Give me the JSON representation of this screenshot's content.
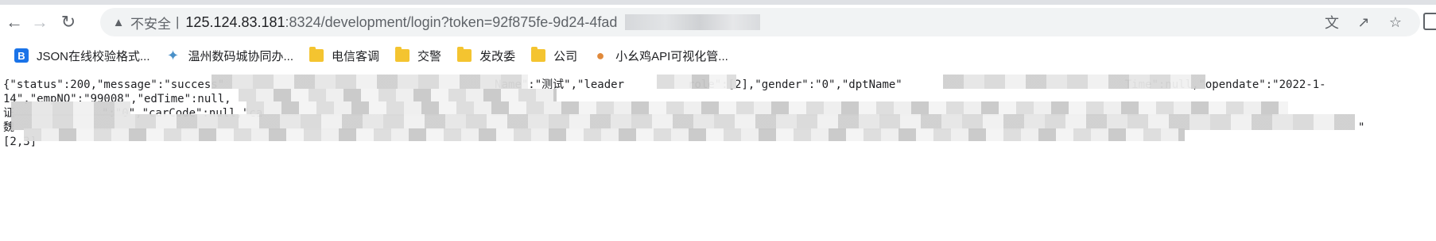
{
  "browser": {
    "nav": {
      "back_icon": "arrow-back-icon",
      "forward_icon": "arrow-forward-icon",
      "reload_icon": "reload-icon"
    },
    "omnibox": {
      "security_icon": "warning-triangle-icon",
      "security_label": "不安全",
      "separator": "|",
      "url_host": "125.124.83.181",
      "url_rest": ":8324/development/login?token=92f875fe-9d24-4fad",
      "actions": [
        "translate-icon",
        "share-icon",
        "bookmark-star-icon"
      ]
    }
  },
  "bookmarks": [
    {
      "label": "JSON在线校验格式...",
      "icon": "json-logo-icon"
    },
    {
      "label": "温州数码城协同办...",
      "icon": "bird-logo-icon"
    },
    {
      "label": "电信客调",
      "icon": "folder-icon"
    },
    {
      "label": "交警",
      "icon": "folder-icon"
    },
    {
      "label": "发改委",
      "icon": "folder-icon"
    },
    {
      "label": "公司",
      "icon": "folder-icon"
    },
    {
      "label": "小幺鸡API可视化管...",
      "icon": "chick-logo-icon"
    }
  ],
  "page": {
    "line1_a": "{\"status\":200,\"message\":\"success\"",
    "line1_b": "Name\":\"测试\",\"leader",
    "line1_c": "role\":[2],\"gender\":\"0\",\"dptName\"",
    "line1_d": "Time\":null,\"opendate\":\"2022-1-",
    "line2": "14\",\"empNO\":\"99008\",\"edTime\":null,",
    "line3_a": "证",
    "line3_b": "\":\"0\",\"carCode\":null,\"ca",
    "line4_a": "魏",
    "line4_b": "\"",
    "line5": "[2,3]"
  }
}
